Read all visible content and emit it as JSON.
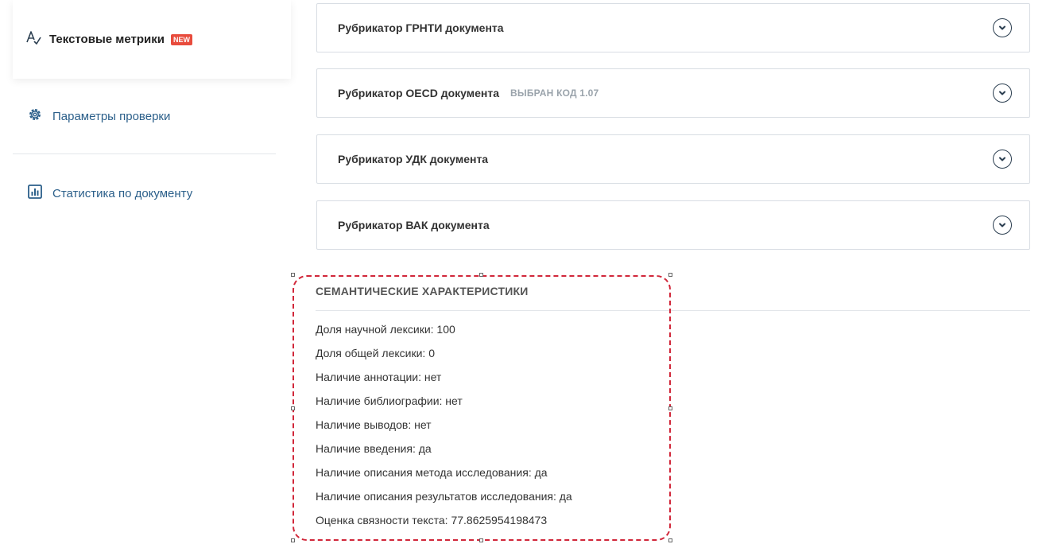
{
  "sidebar": {
    "active_item": {
      "label": "Текстовые метрики",
      "badge": "NEW",
      "icon": "text-metrics-icon"
    },
    "items": [
      {
        "label": "Параметры проверки",
        "icon": "gear-icon"
      },
      {
        "label": "Статистика по документу",
        "icon": "bar-chart-icon"
      }
    ]
  },
  "panels": [
    {
      "title": "Рубрикатор ГРНТИ документа",
      "code": ""
    },
    {
      "title": "Рубрикатор OECD документа",
      "code": "ВЫБРАН КОД 1.07"
    },
    {
      "title": "Рубрикатор УДК документа",
      "code": ""
    },
    {
      "title": "Рубрикатор ВАК документа",
      "code": ""
    }
  ],
  "semantic": {
    "heading": "СЕМАНТИЧЕСКИЕ ХАРАКТЕРИСТИКИ",
    "items": [
      "Доля научной лексики: 100",
      "Доля общей лексики: 0",
      "Наличие аннотации: нет",
      "Наличие библиографии: нет",
      "Наличие выводов: нет",
      "Наличие введения: да",
      "Наличие описания метода исследования: да",
      "Наличие описания результатов исследования: да",
      "Оценка связности текста: 77.8625954198473"
    ]
  },
  "colors": {
    "link": "#2b5f8a",
    "badge": "#e84c3d",
    "selection": "#d1273a",
    "muted": "#9aa3ab"
  }
}
